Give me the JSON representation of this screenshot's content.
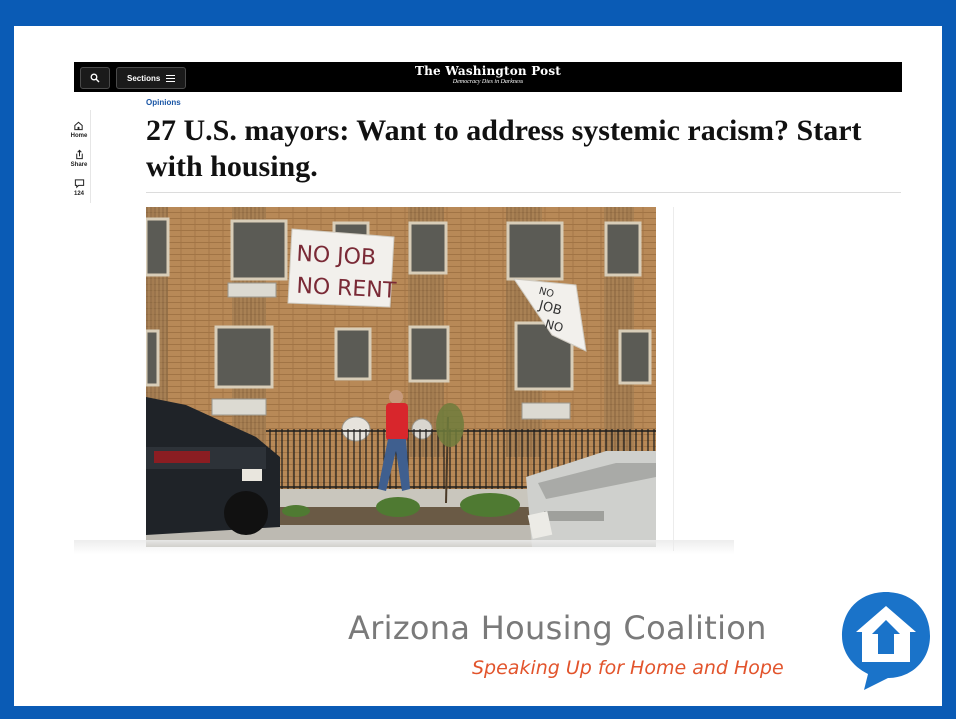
{
  "toolbar": {
    "search_icon": "search-icon",
    "sections_label": "Sections",
    "sections_icon": "hamburger-menu-icon"
  },
  "masthead": {
    "name": "The Washington Post",
    "tagline": "Democracy Dies in Darkness"
  },
  "siderail": {
    "home_label": "Home",
    "share_label": "Share",
    "comments_count": "124"
  },
  "article": {
    "section": "Opinions",
    "headline": "27 U.S. mayors: Want to address systemic racism? Start with housing."
  },
  "photo": {
    "sign_left_line1": "NO JOB",
    "sign_left_line2": "NO RENT",
    "sign_right_line1": "NO",
    "sign_right_line2": "JOB",
    "sign_right_line3": "NO"
  },
  "branding": {
    "name": "Arizona Housing Coalition",
    "tagline": "Speaking Up for Home and Hope",
    "accent": "#e2542c",
    "logo_blue": "#1a73c9"
  }
}
